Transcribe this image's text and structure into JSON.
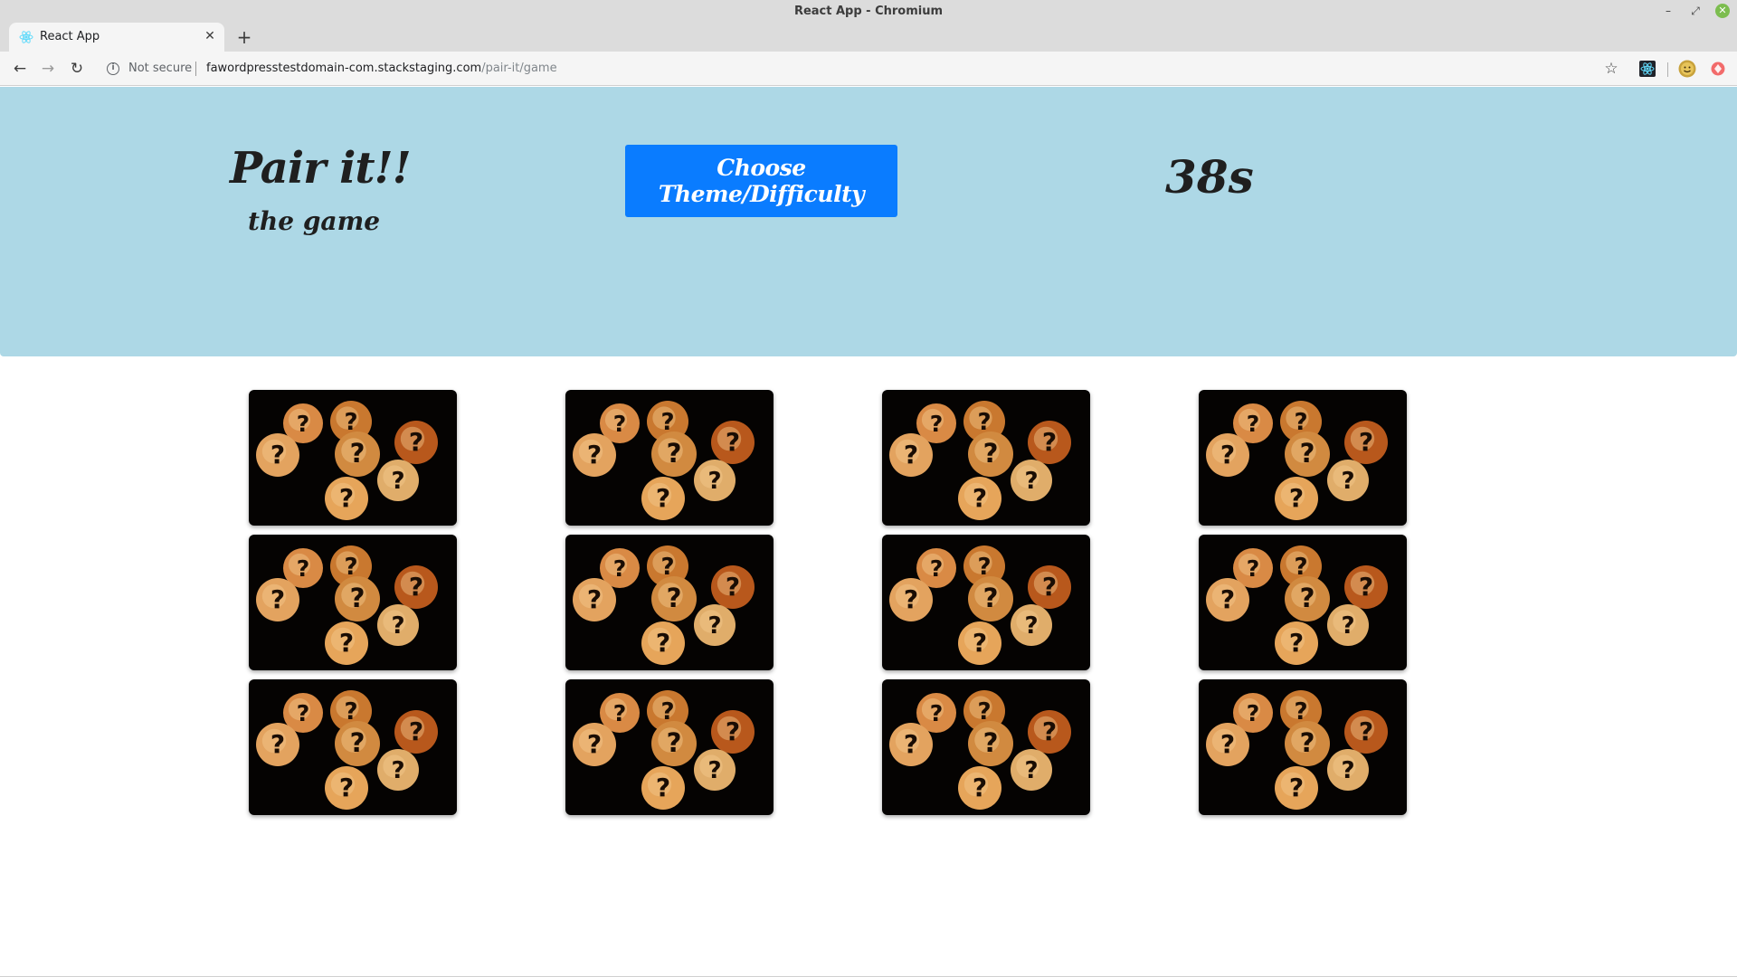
{
  "browser": {
    "window_title": "React App - Chromium",
    "tab_title": "React App",
    "url_host": "fawordpresstestdomain-com.stackstaging.com",
    "url_path": "/pair-it/game",
    "security_label": "Not secure"
  },
  "header": {
    "title": "Pair it!!",
    "subtitle": "the game",
    "theme_button_label": "Choose Theme/Difficulty",
    "timer": "38s"
  },
  "board": {
    "columns": 4,
    "rows": 3,
    "card_back_icon": "question-mark-coins",
    "cards": [
      {
        "state": "face-down"
      },
      {
        "state": "face-down"
      },
      {
        "state": "face-down"
      },
      {
        "state": "face-down"
      },
      {
        "state": "face-down"
      },
      {
        "state": "face-down"
      },
      {
        "state": "face-down"
      },
      {
        "state": "face-down"
      },
      {
        "state": "face-down"
      },
      {
        "state": "face-down"
      },
      {
        "state": "face-down"
      },
      {
        "state": "face-down"
      }
    ]
  },
  "colors": {
    "header_bg": "#add8e6",
    "button_bg": "#0a7cff",
    "card_bg": "#050302"
  }
}
